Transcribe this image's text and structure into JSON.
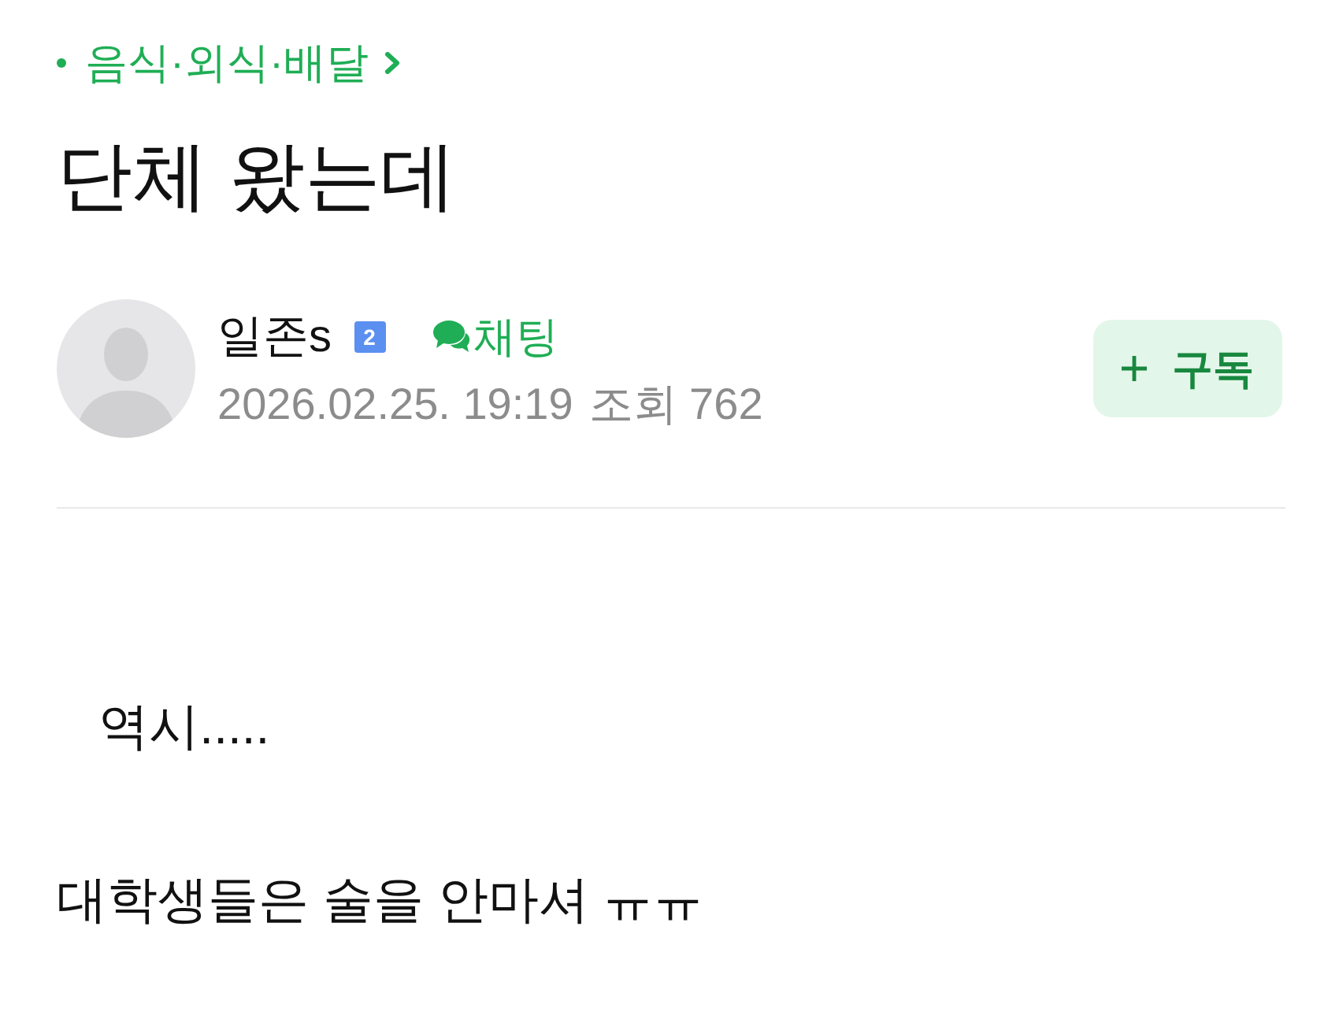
{
  "breadcrumb": {
    "label": "음식·외식·배달"
  },
  "title": "단체 왔는데",
  "author": {
    "name": "일존s",
    "level_badge": "2",
    "chat_label": "채팅",
    "date": "2026.02.25. 19:19",
    "views": "조회 762"
  },
  "subscribe_button": {
    "label": "구독"
  },
  "body": [
    "   역시.....",
    "대학생들은 술을 안마셔 ㅠㅠ"
  ]
}
